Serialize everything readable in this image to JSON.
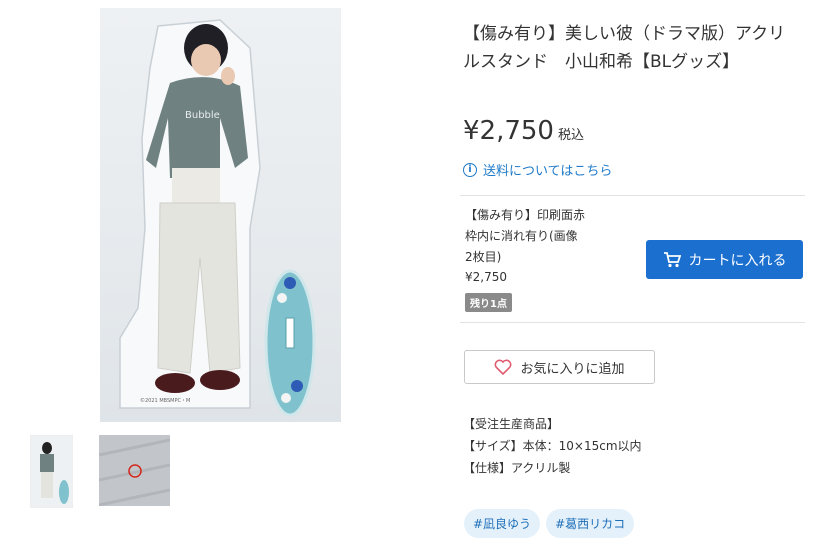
{
  "product": {
    "title": "【傷み有り】美しい彼（ドラマ版）アクリルスタンド　小山和希【BLグッズ】",
    "price": "¥2,750",
    "tax_label": "税込",
    "shipping_link": "送料についてはこちら"
  },
  "variant": {
    "name": "【傷み有り】印刷面赤枠内に消れ有り(画像2枚目)",
    "price": "¥2,750",
    "stock_badge": "残り1点"
  },
  "buttons": {
    "add_to_cart": "カートに入れる",
    "add_favorite": "お気に入りに追加"
  },
  "description": [
    "【受注生産商品】",
    "【サイズ】本体：10×15cm以内",
    "【仕様】アクリル製"
  ],
  "tags": [
    "#凪良ゆう",
    "#葛西リカコ"
  ],
  "photo": {
    "print_text": "Bubble",
    "copyright": "©2021 MBSMPC・M"
  },
  "colors": {
    "accent": "#1b6fcf",
    "link": "#1f7ac9",
    "tag_bg": "#e4f1fb"
  },
  "icons": [
    "info-icon",
    "cart-icon",
    "heart-icon"
  ]
}
